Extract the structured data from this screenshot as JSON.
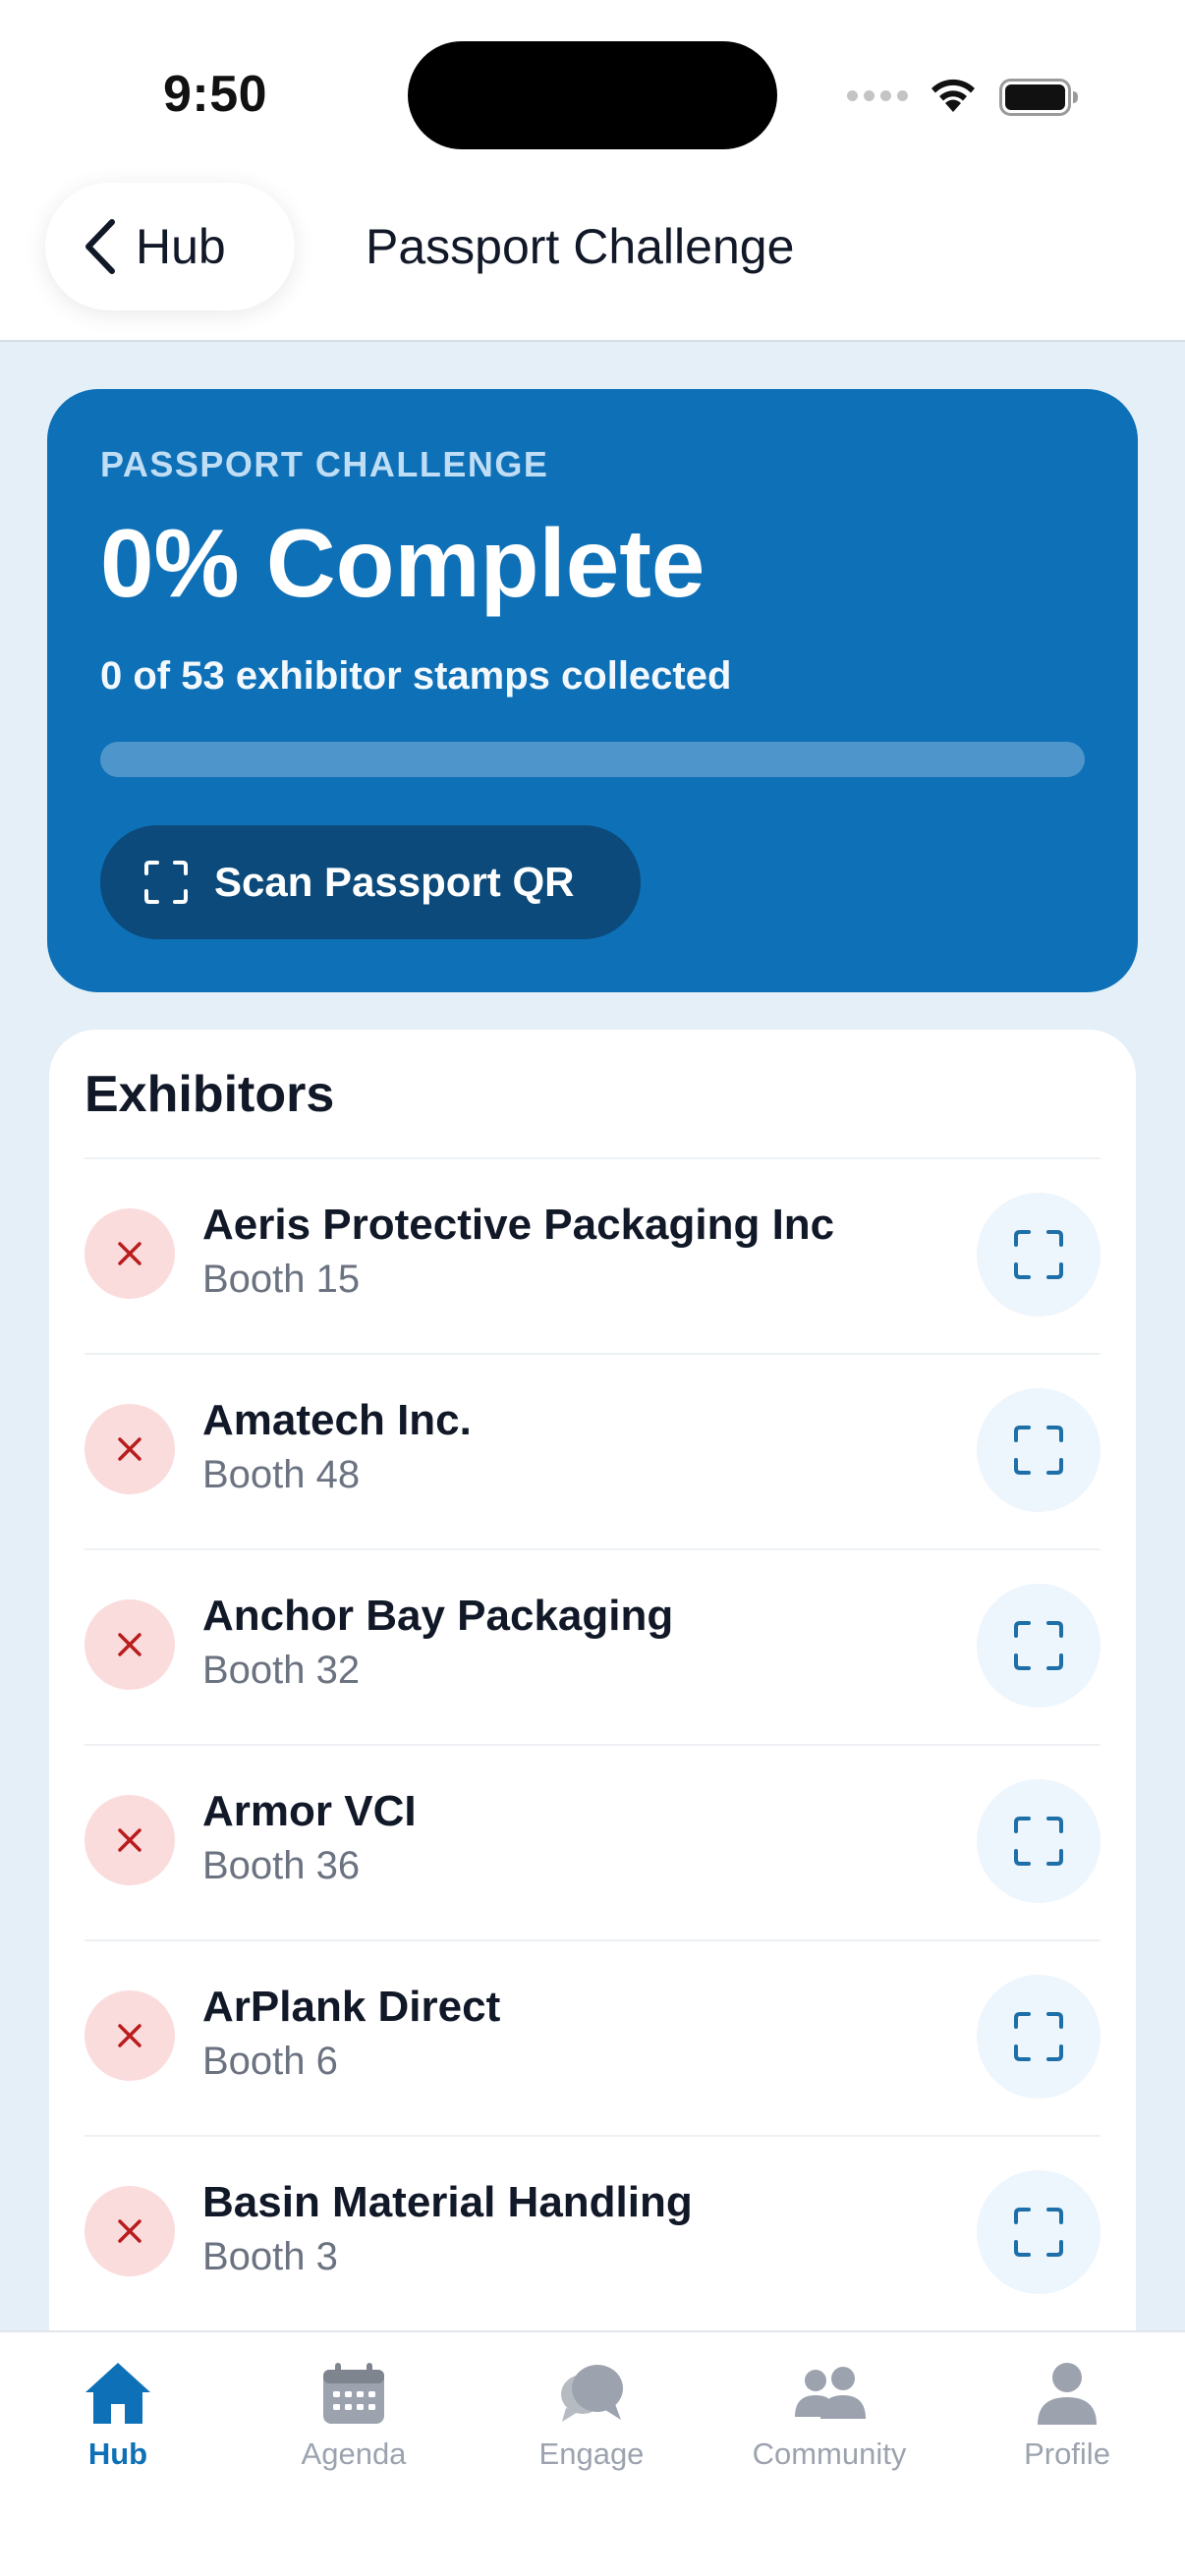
{
  "status_bar": {
    "time": "9:50"
  },
  "header": {
    "back_label": "Hub",
    "title": "Passport Challenge"
  },
  "progress_card": {
    "kicker": "PASSPORT CHALLENGE",
    "title": "0% Complete",
    "subtitle": "0 of 53 exhibitor stamps collected",
    "progress_percent": 0,
    "scan_button_label": "Scan Passport QR"
  },
  "exhibitors": {
    "title": "Exhibitors",
    "items": [
      {
        "name": "Aeris Protective Packaging Inc",
        "booth": "Booth 15",
        "collected": false
      },
      {
        "name": "Amatech Inc.",
        "booth": "Booth 48",
        "collected": false
      },
      {
        "name": "Anchor Bay Packaging",
        "booth": "Booth 32",
        "collected": false
      },
      {
        "name": "Armor VCI",
        "booth": "Booth 36",
        "collected": false
      },
      {
        "name": "ArPlank Direct",
        "booth": "Booth 6",
        "collected": false
      },
      {
        "name": "Basin Material Handling",
        "booth": "Booth 3",
        "collected": false
      }
    ]
  },
  "tabs": [
    {
      "label": "Hub",
      "icon": "home-icon",
      "active": true
    },
    {
      "label": "Agenda",
      "icon": "calendar-icon",
      "active": false
    },
    {
      "label": "Engage",
      "icon": "chat-bubbles-icon",
      "active": false
    },
    {
      "label": "Community",
      "icon": "people-icon",
      "active": false
    },
    {
      "label": "Profile",
      "icon": "person-icon",
      "active": false
    }
  ],
  "colors": {
    "accent": "#0E70B7",
    "scan_button": "#0B4A7A",
    "not_collected_badge": "#FBDCDD",
    "not_collected_mark": "#B91C1C",
    "page_background": "#E4EFF7"
  }
}
